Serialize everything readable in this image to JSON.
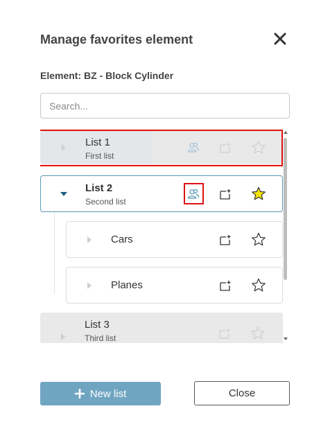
{
  "dialog": {
    "title": "Manage favorites element",
    "element_label": "Element: BZ - Block Cylinder"
  },
  "search": {
    "placeholder": "Search...",
    "value": ""
  },
  "lists": [
    {
      "name": "List 1",
      "subtitle": "First list",
      "expanded": false,
      "favorite": false,
      "disabled": true
    },
    {
      "name": "List 2",
      "subtitle": "Second list",
      "expanded": true,
      "favorite": true,
      "disabled": false,
      "children": [
        {
          "name": "Cars",
          "favorite": false
        },
        {
          "name": "Planes",
          "favorite": false
        }
      ]
    },
    {
      "name": "List 3",
      "subtitle": "Third list",
      "expanded": false,
      "favorite": false,
      "disabled": true
    }
  ],
  "icons": {
    "close": "close-icon",
    "expand": "chevron-right-icon",
    "collapse": "chevron-down-icon",
    "share": "users-share-icon",
    "add_folder": "folder-add-icon",
    "favorite": "star-icon",
    "plus": "plus-icon"
  },
  "footer": {
    "new_list_label": "New list",
    "close_label": "Close"
  },
  "colors": {
    "primary": "#6fa5c1",
    "accent_border": "#5b98b4",
    "favorite_star": "#f2e40a",
    "highlight_frame": "#e01010",
    "disabled_row": "#e9e9e9"
  }
}
